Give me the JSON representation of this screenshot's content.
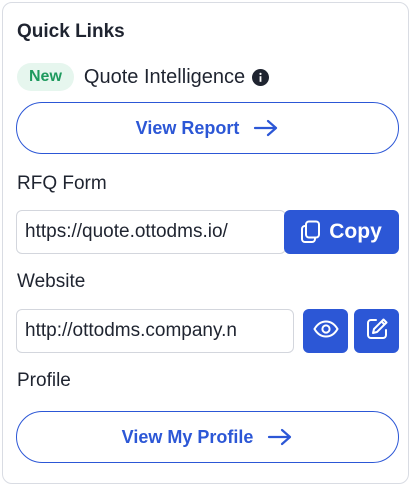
{
  "quick_links": {
    "title": "Quick Links",
    "badge": "New",
    "feature_label": "Quote Intelligence",
    "view_report_label": "View Report"
  },
  "rfq": {
    "label": "RFQ Form",
    "url": "https://quote.ottodms.io/",
    "copy_label": "Copy"
  },
  "website": {
    "label": "Website",
    "url": "http://ottodms.company.n"
  },
  "profile": {
    "label": "Profile",
    "button_label": "View My Profile"
  },
  "icons": {
    "info": "info-icon",
    "arrow": "arrow-right-icon",
    "copy": "copy-icon",
    "view": "eye-icon",
    "edit": "edit-icon"
  },
  "colors": {
    "accent": "#2c57d6",
    "badge_bg": "#e6f6ee",
    "badge_text": "#1e9a5e"
  }
}
